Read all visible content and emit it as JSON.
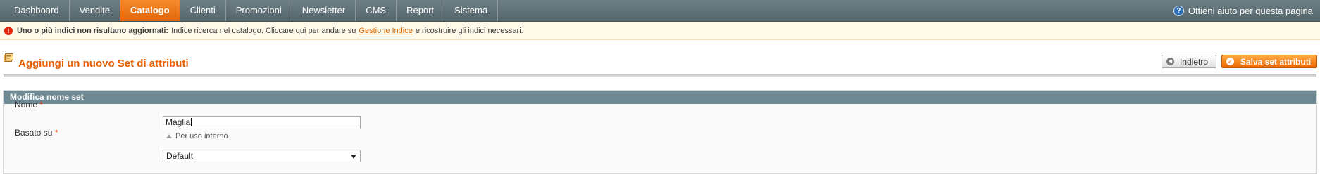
{
  "nav": {
    "items": [
      {
        "label": "Dashboard",
        "active": false
      },
      {
        "label": "Vendite",
        "active": false
      },
      {
        "label": "Catalogo",
        "active": true
      },
      {
        "label": "Clienti",
        "active": false
      },
      {
        "label": "Promozioni",
        "active": false
      },
      {
        "label": "Newsletter",
        "active": false
      },
      {
        "label": "CMS",
        "active": false
      },
      {
        "label": "Report",
        "active": false
      },
      {
        "label": "Sistema",
        "active": false
      }
    ],
    "help_icon": "help-circle-icon",
    "help_label": "Ottieni aiuto per questa pagina"
  },
  "notice": {
    "icon": "error-icon",
    "bold": "Uno o più indici non risultano aggiornati:",
    "text_before": "Indice ricerca nel catalogo. Cliccare qui per andare su",
    "link": "Gestione Indice",
    "text_after": "e ricostruire gli indici necessari."
  },
  "header": {
    "icon": "attribute-set-icon",
    "title": "Aggiungi un nuovo Set di attributi",
    "back_label": "Indietro",
    "save_label": "Salva set attributi"
  },
  "form": {
    "section_title": "Modifica nome set",
    "name_label": "Nome",
    "required_mark": "*",
    "name_value": "Maglia",
    "name_note": "Per uso interno.",
    "based_label": "Basato su",
    "based_value": "Default"
  },
  "colors": {
    "nav_bg": "#607277",
    "accent": "#eb5e00",
    "section_head": "#6f8992",
    "notice_bg": "#fff9e9",
    "error": "#df280a"
  }
}
